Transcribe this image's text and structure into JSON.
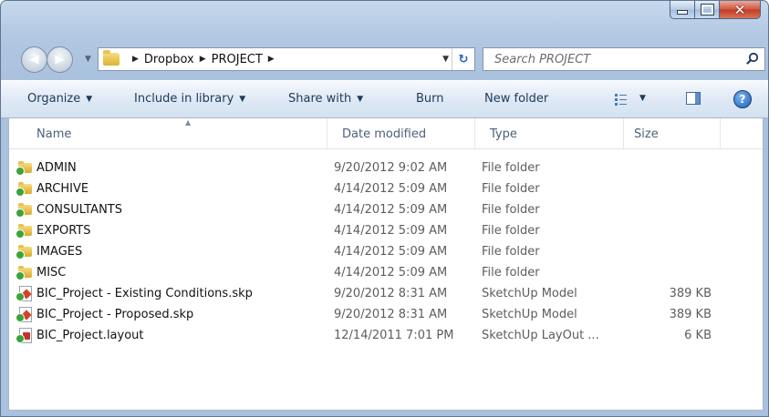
{
  "window": {
    "caption": {
      "minimize": "minimize",
      "maximize": "maximize",
      "close": "x"
    }
  },
  "address_bar": {
    "breadcrumbs": [
      "Dropbox",
      "PROJECT"
    ],
    "search_placeholder": "Search PROJECT"
  },
  "toolbar": {
    "organize": "Organize",
    "include_in_library": "Include in library",
    "share_with": "Share with",
    "burn": "Burn",
    "new_folder": "New folder"
  },
  "columns": {
    "name": "Name",
    "date_modified": "Date modified",
    "type": "Type",
    "size": "Size"
  },
  "files": [
    {
      "name": "ADMIN",
      "date": "9/20/2012 9:02 AM",
      "type": "File folder",
      "size": "",
      "icon": "folder-icon"
    },
    {
      "name": "ARCHIVE",
      "date": "4/14/2012 5:09 AM",
      "type": "File folder",
      "size": "",
      "icon": "folder-icon"
    },
    {
      "name": "CONSULTANTS",
      "date": "4/14/2012 5:09 AM",
      "type": "File folder",
      "size": "",
      "icon": "folder-icon"
    },
    {
      "name": "EXPORTS",
      "date": "4/14/2012 5:09 AM",
      "type": "File folder",
      "size": "",
      "icon": "folder-icon"
    },
    {
      "name": "IMAGES",
      "date": "4/14/2012 5:09 AM",
      "type": "File folder",
      "size": "",
      "icon": "folder-icon"
    },
    {
      "name": "MISC",
      "date": "4/14/2012 5:09 AM",
      "type": "File folder",
      "size": "",
      "icon": "folder-icon"
    },
    {
      "name": "BIC_Project - Existing Conditions.skp",
      "date": "9/20/2012 8:31 AM",
      "type": "SketchUp Model",
      "size": "389 KB",
      "icon": "sketchup-file-icon"
    },
    {
      "name": "BIC_Project - Proposed.skp",
      "date": "9/20/2012 8:31 AM",
      "type": "SketchUp Model",
      "size": "389 KB",
      "icon": "sketchup-file-icon"
    },
    {
      "name": "BIC_Project.layout",
      "date": "12/14/2011 7:01 PM",
      "type": "SketchUp LayOut ...",
      "size": "6 KB",
      "icon": "layout-file-icon"
    }
  ],
  "colors": {
    "accent": "#1e395b",
    "frame": "#b1c8e2",
    "synced_badge": "#3aa43a"
  }
}
